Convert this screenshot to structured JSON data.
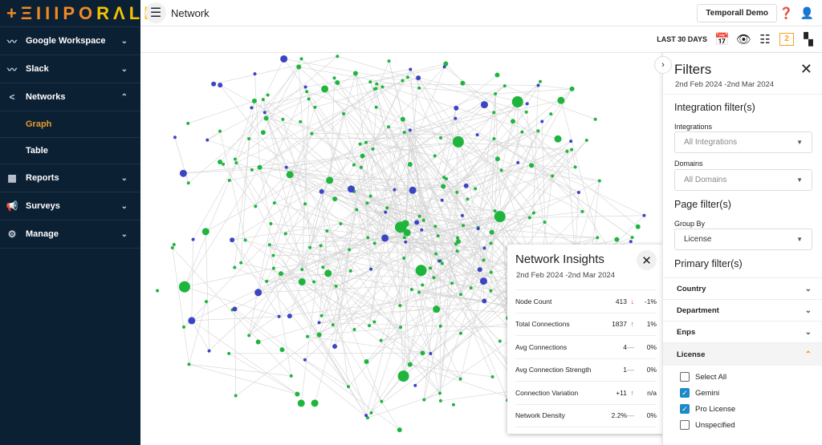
{
  "brand": {
    "logo_text": "TEMPORALL",
    "accent": "#f08a24"
  },
  "sidebar": {
    "items": [
      {
        "label": "Google Workspace",
        "icon": "trend-icon",
        "expanded": false
      },
      {
        "label": "Slack",
        "icon": "trend-icon",
        "expanded": false
      },
      {
        "label": "Networks",
        "icon": "share-icon",
        "expanded": true,
        "children": [
          {
            "label": "Graph",
            "active": true
          },
          {
            "label": "Table",
            "active": false
          }
        ]
      },
      {
        "label": "Reports",
        "icon": "bar-chart-icon",
        "expanded": false
      },
      {
        "label": "Surveys",
        "icon": "megaphone-icon",
        "expanded": false
      },
      {
        "label": "Manage",
        "icon": "gear-icon",
        "expanded": false
      }
    ]
  },
  "header": {
    "title": "Network",
    "account_button": "Temporall Demo"
  },
  "toolbar": {
    "range_label": "LAST 30 DAYS",
    "icons": [
      "calendar-icon",
      "eye-icon",
      "tune-icon",
      "filter-count-icon",
      "dashboard-icon"
    ],
    "filter_count": "2"
  },
  "graph": {
    "colors": {
      "Gemini": "#1fb53d",
      "Pro License": "#3b45c4",
      "edge": "#d4d4d4"
    }
  },
  "filters": {
    "title": "Filters",
    "date_range": "2nd Feb 2024 -2nd Mar 2024",
    "integration_section": "Integration filter(s)",
    "integrations": {
      "label": "Integrations",
      "value": "All Integrations"
    },
    "domains": {
      "label": "Domains",
      "value": "All Domains"
    },
    "page_section": "Page filter(s)",
    "group_by": {
      "label": "Group By",
      "value": "License"
    },
    "primary_section": "Primary filter(s)",
    "accordions": [
      "Country",
      "Department",
      "Enps",
      "License"
    ],
    "license_options": [
      {
        "label": "Select All",
        "checked": false
      },
      {
        "label": "Gemini",
        "checked": true
      },
      {
        "label": "Pro License",
        "checked": true
      },
      {
        "label": "Unspecified",
        "checked": false
      }
    ]
  },
  "insights": {
    "title": "Network Insights",
    "date_range": "2nd Feb 2024 -2nd Mar 2024",
    "rows": [
      {
        "label": "Node Count",
        "value": "413",
        "trend": "down",
        "change": "-1%"
      },
      {
        "label": "Total Connections",
        "value": "1837",
        "trend": "up",
        "change": "1%"
      },
      {
        "label": "Avg Connections",
        "value": "4",
        "trend": "flat",
        "change": "0%"
      },
      {
        "label": "Avg Connection Strength",
        "value": "1",
        "trend": "flat",
        "change": "0%"
      },
      {
        "label": "Connection Variation",
        "value": "+11",
        "trend": "up",
        "change": "n/a"
      },
      {
        "label": "Network Density",
        "value": "2.2%",
        "trend": "flat",
        "change": "0%"
      }
    ]
  }
}
